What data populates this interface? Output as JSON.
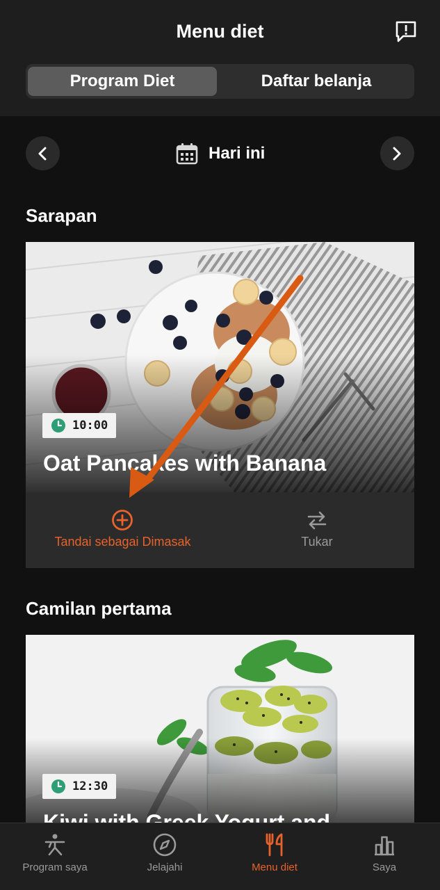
{
  "header": {
    "title": "Menu diet",
    "feedback_icon": "feedback-icon"
  },
  "segment": {
    "active": "Program Diet",
    "inactive": "Daftar belanja"
  },
  "date_nav": {
    "label": "Hari ini",
    "prev_icon": "chevron-left-icon",
    "next_icon": "chevron-right-icon",
    "calendar_icon": "calendar-icon"
  },
  "meals": [
    {
      "section": "Sarapan",
      "time": "10:00",
      "title": "Oat Pancakes with Banana",
      "actions": {
        "cook_label": "Tandai sebagai Dimasak",
        "swap_label": "Tukar"
      }
    },
    {
      "section": "Camilan pertama",
      "time": "12:30",
      "title": "Kiwi with Greek Yogurt and"
    }
  ],
  "tabbar": [
    {
      "label": "Program saya",
      "icon": "workout-figure-icon"
    },
    {
      "label": "Jelajahi",
      "icon": "compass-icon"
    },
    {
      "label": "Menu diet",
      "icon": "fork-knife-icon"
    },
    {
      "label": "Saya",
      "icon": "bar-chart-icon"
    }
  ],
  "colors": {
    "accent": "#e8622b",
    "background": "#111111",
    "card_actions": "#2b2b2b",
    "badge_clock": "#2e9e77"
  }
}
